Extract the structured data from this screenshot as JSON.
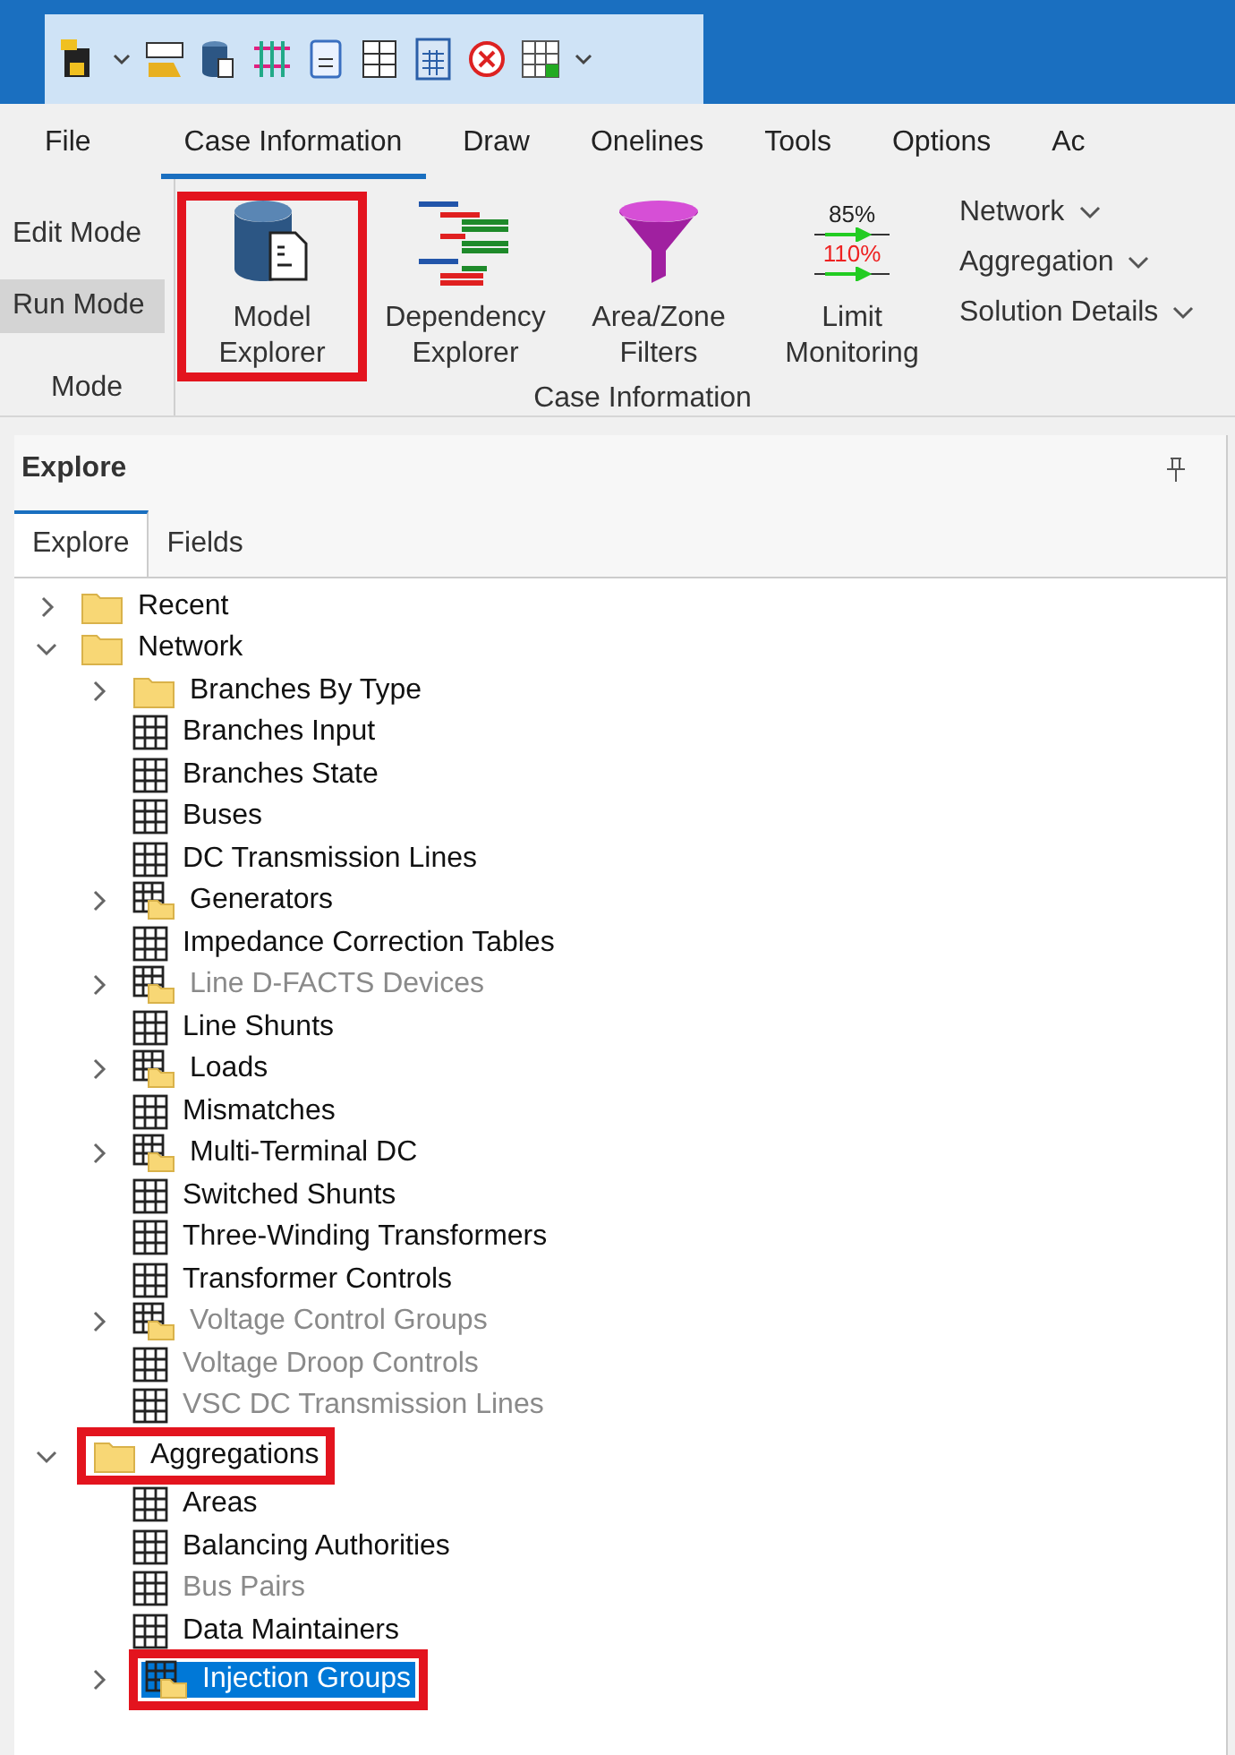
{
  "ribbon": {
    "tabs": [
      {
        "label": "File",
        "selected": false
      },
      {
        "label": "Case Information",
        "selected": true
      },
      {
        "label": "Draw",
        "selected": false
      },
      {
        "label": "Onelines",
        "selected": false
      },
      {
        "label": "Tools",
        "selected": false
      },
      {
        "label": "Options",
        "selected": false
      },
      {
        "label": "Ac",
        "selected": false
      }
    ],
    "mode_group": {
      "label": "Mode",
      "items": [
        {
          "label": "Edit Mode",
          "selected": false
        },
        {
          "label": "Run Mode",
          "selected": true
        }
      ]
    },
    "case_group": {
      "label": "Case Information",
      "large_buttons": [
        {
          "kind": "database",
          "label": "Model Explorer",
          "highlighted": true
        },
        {
          "kind": "dependency",
          "label": "Dependency Explorer"
        },
        {
          "kind": "funnel",
          "label": "Area/Zone Filters"
        },
        {
          "kind": "limits",
          "label": "Limit Monitoring",
          "readings": [
            "85%",
            "110%"
          ]
        }
      ],
      "dropdowns": [
        {
          "label": "Network"
        },
        {
          "label": "Aggregation"
        },
        {
          "label": "Solution Details"
        }
      ]
    }
  },
  "explore_panel": {
    "title": "Explore",
    "tabs": [
      {
        "label": "Explore",
        "selected": true
      },
      {
        "label": "Fields",
        "selected": false
      }
    ],
    "tree": [
      {
        "label": "Recent",
        "kind": "folder",
        "expanded": false
      },
      {
        "label": "Network",
        "kind": "folder",
        "expanded": true,
        "children": [
          {
            "label": "Branches By Type",
            "kind": "folder",
            "expanded": false
          },
          {
            "label": "Branches Input",
            "kind": "table"
          },
          {
            "label": "Branches State",
            "kind": "table"
          },
          {
            "label": "Buses",
            "kind": "table"
          },
          {
            "label": "DC Transmission Lines",
            "kind": "table"
          },
          {
            "label": "Generators",
            "kind": "table-folder",
            "expanded": false
          },
          {
            "label": "Impedance Correction Tables",
            "kind": "table"
          },
          {
            "label": "Line D-FACTS Devices",
            "kind": "table-folder",
            "expanded": false,
            "disabled": true
          },
          {
            "label": "Line Shunts",
            "kind": "table"
          },
          {
            "label": "Loads",
            "kind": "table-folder",
            "expanded": false
          },
          {
            "label": "Mismatches",
            "kind": "table"
          },
          {
            "label": "Multi-Terminal DC",
            "kind": "table-folder",
            "expanded": false
          },
          {
            "label": "Switched Shunts",
            "kind": "table"
          },
          {
            "label": "Three-Winding Transformers",
            "kind": "table"
          },
          {
            "label": "Transformer Controls",
            "kind": "table"
          },
          {
            "label": "Voltage Control Groups",
            "kind": "table-folder",
            "expanded": false,
            "disabled": true
          },
          {
            "label": "Voltage Droop Controls",
            "kind": "table",
            "disabled": true
          },
          {
            "label": "VSC DC Transmission Lines",
            "kind": "table",
            "disabled": true
          }
        ]
      },
      {
        "label": "Aggregations",
        "kind": "folder",
        "expanded": true,
        "highlighted": true,
        "children": [
          {
            "label": "Areas",
            "kind": "table"
          },
          {
            "label": "Balancing Authorities",
            "kind": "table"
          },
          {
            "label": "Bus Pairs",
            "kind": "table",
            "disabled": true
          },
          {
            "label": "Data Maintainers",
            "kind": "table"
          },
          {
            "label": "Injection Groups",
            "kind": "table-folder",
            "expanded": false,
            "selected": true,
            "highlighted": true
          }
        ]
      }
    ]
  }
}
